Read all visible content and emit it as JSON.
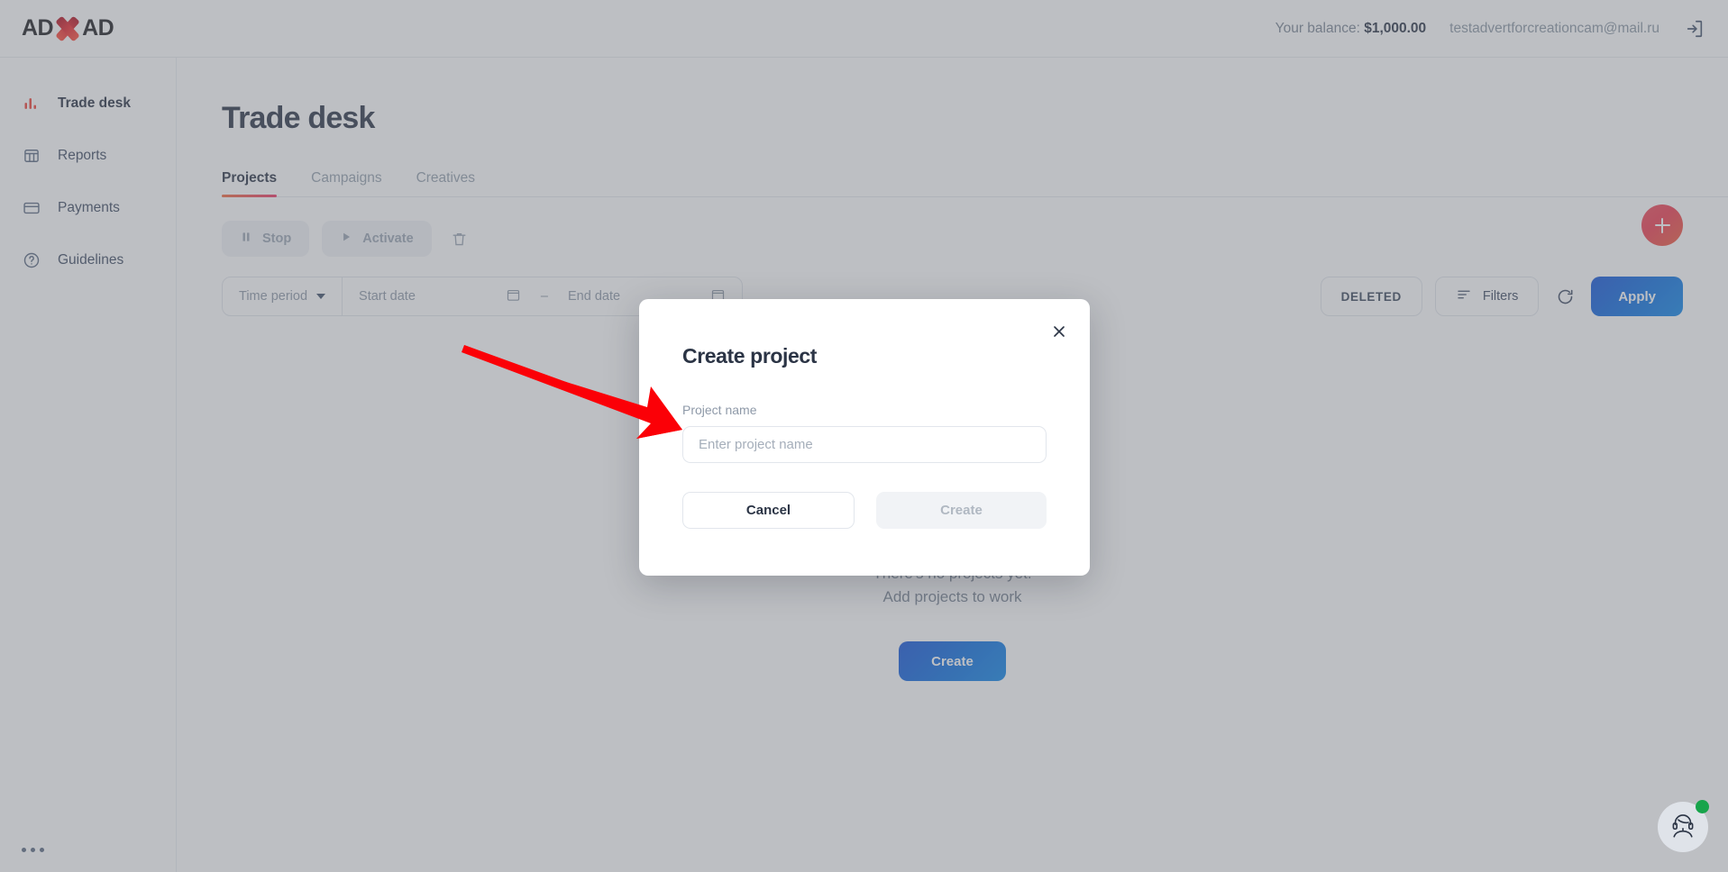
{
  "header": {
    "logo_part1": "AD",
    "logo_part2": "AD",
    "logo_x_icon": "x-mark-icon",
    "balance_label": "Your balance:",
    "balance_value": "$1,000.00",
    "user_email": "testadvertforcreationcam@mail.ru",
    "logout_icon": "logout-icon"
  },
  "sidebar": {
    "items": [
      {
        "label": "Trade desk",
        "icon": "bar-chart-icon",
        "active": true
      },
      {
        "label": "Reports",
        "icon": "table-icon",
        "active": false
      },
      {
        "label": "Payments",
        "icon": "credit-card-icon",
        "active": false
      },
      {
        "label": "Guidelines",
        "icon": "question-circle-icon",
        "active": false
      }
    ],
    "more_icon": "ellipsis-icon"
  },
  "main": {
    "page_title": "Trade desk",
    "tabs": [
      {
        "label": "Projects",
        "active": true
      },
      {
        "label": "Campaigns",
        "active": false
      },
      {
        "label": "Creatives",
        "active": false
      }
    ],
    "actions": {
      "stop_label": "Stop",
      "stop_icon": "pause-icon",
      "activate_label": "Activate",
      "activate_icon": "play-icon",
      "delete_icon": "trash-icon"
    },
    "filters": {
      "time_period_label": "Time period",
      "time_period_caret": "chevron-down-icon",
      "start_date_placeholder": "Start date",
      "calendar_icon": "calendar-icon",
      "range_separator": "–",
      "end_date_placeholder": "End date",
      "deleted_label": "DELETED",
      "filters_label": "Filters",
      "filters_icon": "filter-lines-icon",
      "refresh_icon": "refresh-icon",
      "apply_label": "Apply"
    },
    "fab_icon": "plus-icon",
    "empty_state": {
      "line1": "There's no projects yet.",
      "line2": "Add projects to work",
      "create_label": "Create"
    }
  },
  "modal": {
    "title": "Create project",
    "close_icon": "close-icon",
    "field_label": "Project name",
    "input_value": "",
    "input_placeholder": "Enter project name",
    "cancel_label": "Cancel",
    "create_label": "Create"
  },
  "chat": {
    "avatar_icon": "support-agent-icon",
    "status": "online"
  },
  "colors": {
    "accent_red": "#ef4136",
    "accent_blue": "#0b6fe0",
    "tab_underline_from": "#f26a3c",
    "tab_underline_to": "#ee3465",
    "online_green": "#17a44b",
    "annotation_red": "#fb0007"
  }
}
